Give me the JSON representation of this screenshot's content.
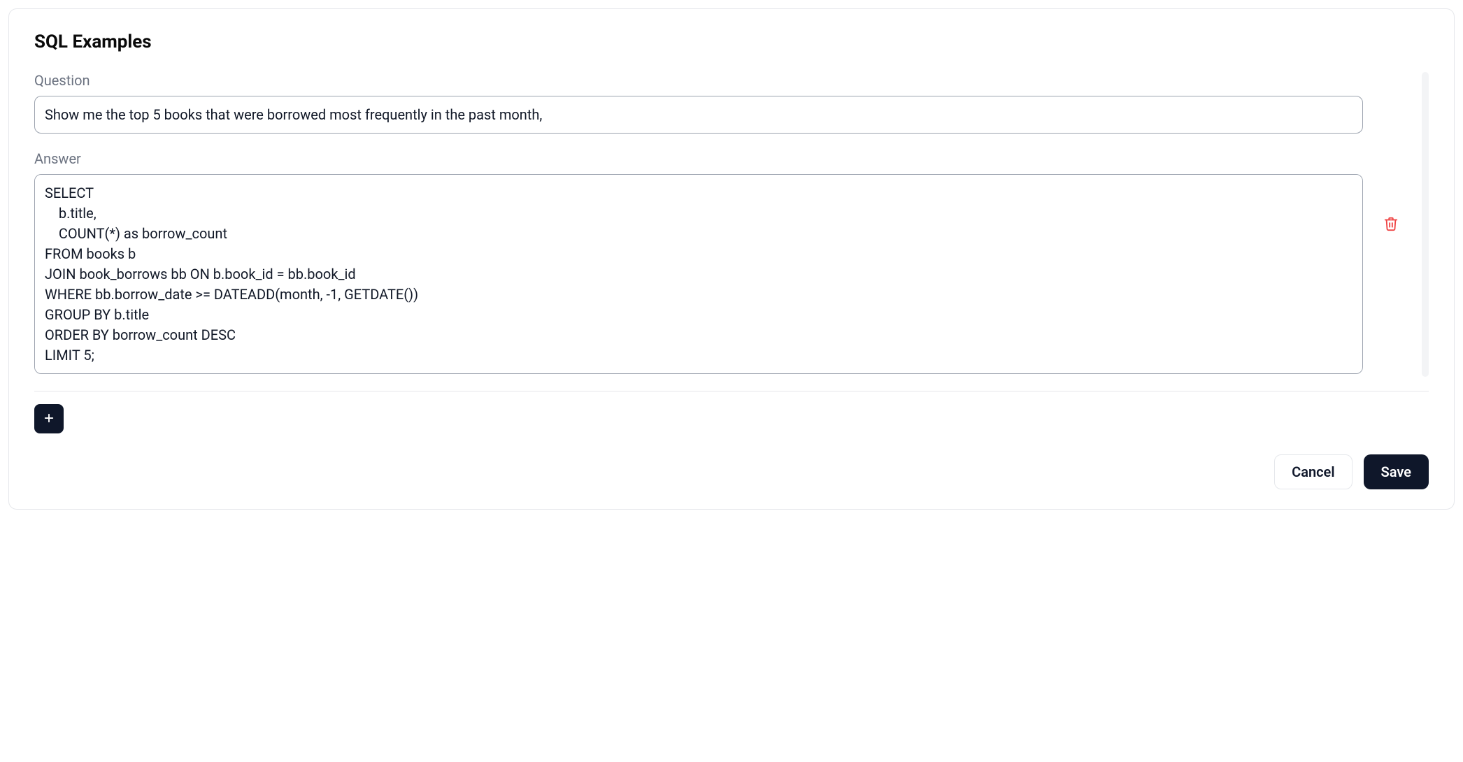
{
  "section": {
    "title": "SQL Examples",
    "question_label": "Question",
    "answer_label": "Answer",
    "question_value": "Show me the top 5 books that were borrowed most frequently in the past month,",
    "answer_value": "SELECT \n    b.title,\n    COUNT(*) as borrow_count\nFROM books b\nJOIN book_borrows bb ON b.book_id = bb.book_id\nWHERE bb.borrow_date >= DATEADD(month, -1, GETDATE())\nGROUP BY b.title\nORDER BY borrow_count DESC\nLIMIT 5;"
  },
  "actions": {
    "cancel_label": "Cancel",
    "save_label": "Save"
  }
}
